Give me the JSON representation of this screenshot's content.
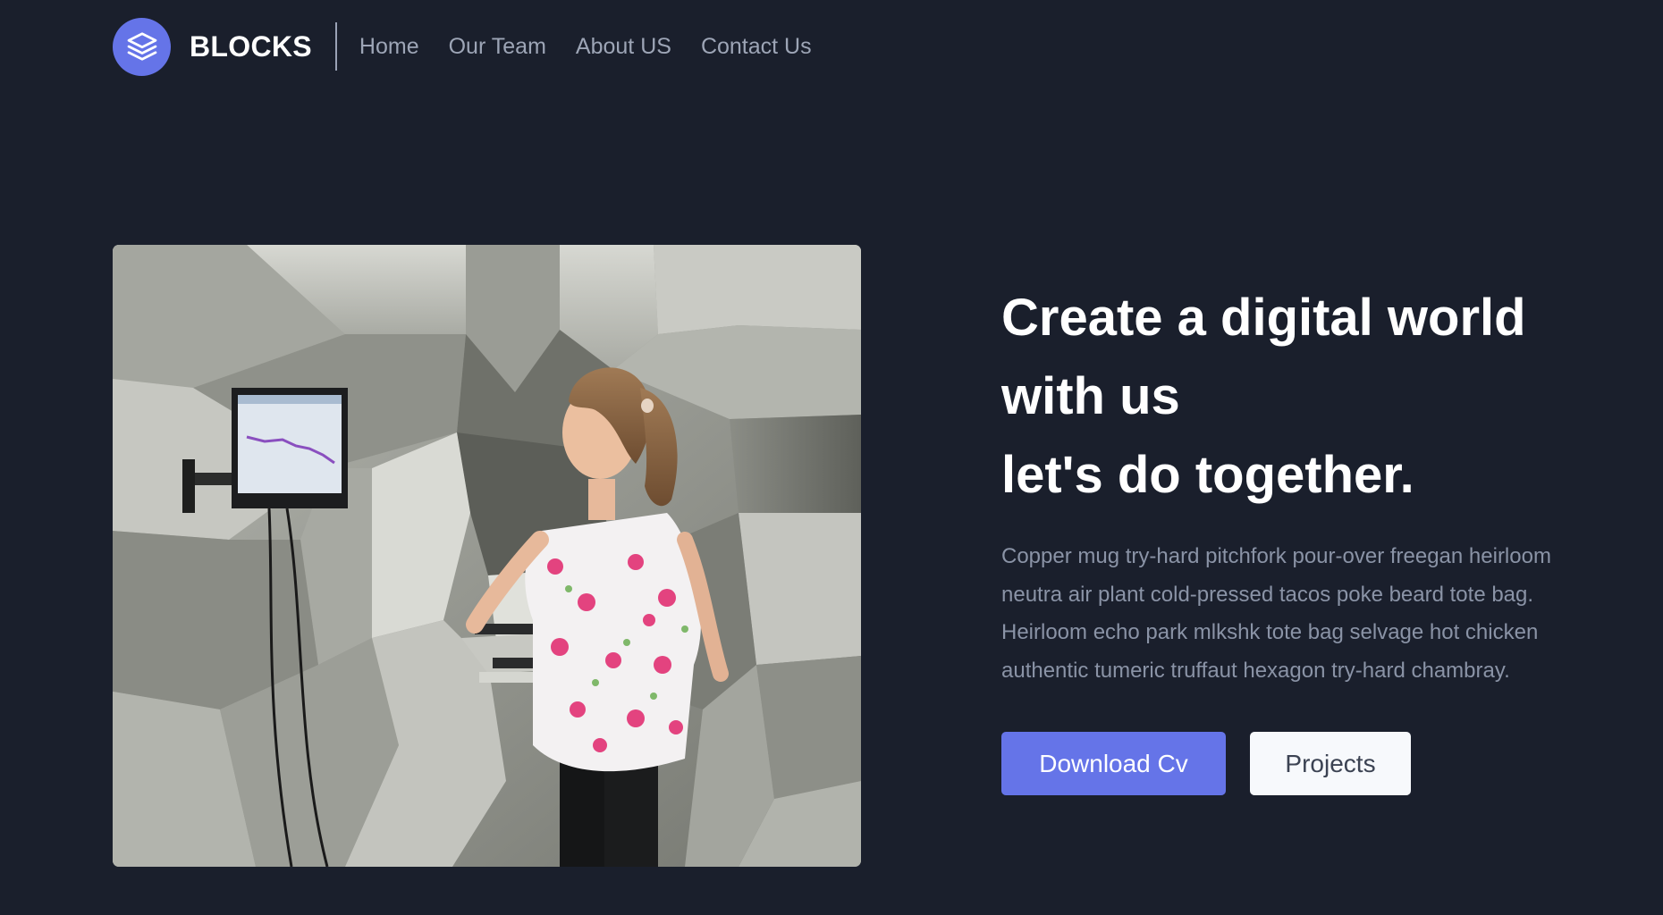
{
  "brand": {
    "name": "BLOCKS",
    "accent_color": "#6574e8",
    "logo_icon": "stacked-layers-icon"
  },
  "nav": {
    "items": [
      {
        "label": "Home"
      },
      {
        "label": "Our Team"
      },
      {
        "label": "About US"
      },
      {
        "label": "Contact Us"
      }
    ]
  },
  "hero": {
    "title_lines": [
      "Create a digital world",
      "with us",
      "let's do together."
    ],
    "description": "Copper mug try-hard pitchfork pour-over freegan heirloom neutra air plant cold-pressed tacos poke beard tote bag. Heirloom echo park mlkshk tote bag selvage hot chicken authentic tumeric truffaut hexagon try-hard chambray.",
    "primary_button": "Download Cv",
    "secondary_button": "Projects"
  },
  "colors": {
    "background": "#1a1f2c",
    "muted_text": "#8a93a6",
    "button_light": "#f7f9fc"
  }
}
